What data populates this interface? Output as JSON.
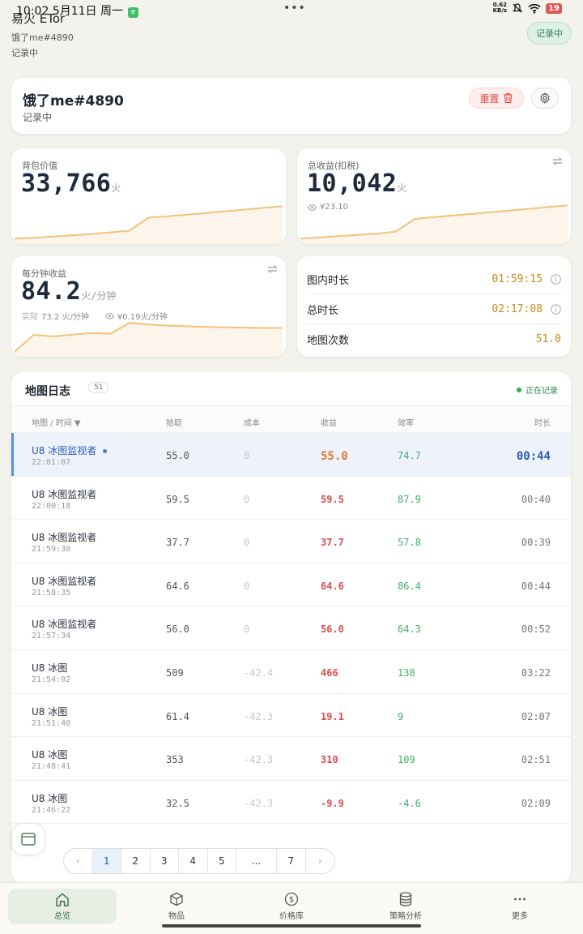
{
  "statusbar": {
    "time": "10:02",
    "date": "5月11日 周一",
    "app_badge": "e",
    "dots": "•••",
    "net_speed": "0.62",
    "net_unit": "KB/s",
    "battery": "19"
  },
  "header": {
    "title": "易火 ETor",
    "username": "饿了me#4890",
    "status": "记录中",
    "recording_pill": "记录中"
  },
  "profile": {
    "name": "饿了me#4890",
    "status": "记录中",
    "reset_label": "重置"
  },
  "stats": {
    "backpack": {
      "label": "背包价值",
      "value": "33,766",
      "unit": "火",
      "trend": [
        0.05,
        0.07,
        0.1,
        0.13,
        0.16,
        0.2,
        0.24,
        0.55,
        0.58,
        0.62,
        0.66,
        0.7,
        0.74,
        0.78,
        0.82
      ]
    },
    "total": {
      "label": "总收益(扣税)",
      "value": "10,042",
      "unit": "火",
      "sub": "¥23.10",
      "trend": [
        0.05,
        0.08,
        0.11,
        0.14,
        0.17,
        0.22,
        0.52,
        0.56,
        0.6,
        0.64,
        0.68,
        0.72,
        0.76,
        0.8,
        0.84
      ]
    },
    "per_minute": {
      "label": "每分钟收益",
      "value": "84.2",
      "unit": "火/分钟",
      "sub_real_label": "实际",
      "sub_real_value": "73.2 火/分钟",
      "sub_cny": "¥0.19火/分钟",
      "trend": [
        0.05,
        0.55,
        0.5,
        0.55,
        0.6,
        0.58,
        0.9,
        0.85,
        0.82,
        0.8,
        0.78,
        0.77,
        0.76,
        0.75,
        0.75
      ]
    }
  },
  "times": [
    {
      "label": "图内时长",
      "value": "01:59:15"
    },
    {
      "label": "总时长",
      "value": "02:17:08"
    },
    {
      "label": "地图次数",
      "value": "51.0"
    }
  ],
  "log": {
    "title": "地图日志",
    "count": "51",
    "recording": "正在记录",
    "headers": [
      "地图 / 时间 ▼",
      "拾取",
      "成本",
      "收益",
      "效率",
      "时长"
    ],
    "rows": [
      {
        "map": "U8 冰图监视者",
        "time": "22:01:07",
        "pickup": "55.0",
        "cost": "0",
        "revenue": "55.0",
        "efficiency": "74.7",
        "duration": "00:44"
      },
      {
        "map": "U8 冰图监视者",
        "time": "22:00:18",
        "pickup": "59.5",
        "cost": "0",
        "revenue": "59.5",
        "efficiency": "87.9",
        "duration": "00:40"
      },
      {
        "map": "U8 冰图监视者",
        "time": "21:59:30",
        "pickup": "37.7",
        "cost": "0",
        "revenue": "37.7",
        "efficiency": "57.8",
        "duration": "00:39"
      },
      {
        "map": "U8 冰图监视者",
        "time": "21:58:35",
        "pickup": "64.6",
        "cost": "0",
        "revenue": "64.6",
        "efficiency": "86.4",
        "duration": "00:44"
      },
      {
        "map": "U8 冰图监视者",
        "time": "21:57:34",
        "pickup": "56.0",
        "cost": "0",
        "revenue": "56.0",
        "efficiency": "64.3",
        "duration": "00:52"
      },
      {
        "map": "U8 冰图",
        "time": "21:54:02",
        "pickup": "509",
        "cost": "-42.4",
        "revenue": "466",
        "efficiency": "138",
        "duration": "03:22"
      },
      {
        "map": "U8 冰图",
        "time": "21:51:40",
        "pickup": "61.4",
        "cost": "-42.3",
        "revenue": "19.1",
        "efficiency": "9",
        "duration": "02:07"
      },
      {
        "map": "U8 冰图",
        "time": "21:48:41",
        "pickup": "353",
        "cost": "-42.3",
        "revenue": "310",
        "efficiency": "109",
        "duration": "02:51"
      },
      {
        "map": "U8 冰图",
        "time": "21:46:22",
        "pickup": "32.5",
        "cost": "-42.3",
        "revenue": "-9.9",
        "efficiency": "-4.6",
        "duration": "02:09"
      }
    ]
  },
  "pager": {
    "prev": "‹",
    "pages": [
      "1",
      "2",
      "3",
      "4",
      "5",
      "...",
      "7"
    ],
    "next": "›",
    "current": "1"
  },
  "nav": [
    {
      "label": "总览",
      "icon": "home-icon"
    },
    {
      "label": "物品",
      "icon": "box-icon"
    },
    {
      "label": "价格库",
      "icon": "dollar-icon"
    },
    {
      "label": "策略分析",
      "icon": "database-icon"
    },
    {
      "label": "更多",
      "icon": "more-icon"
    }
  ],
  "colors": {
    "accent_orange": "#c98a1a",
    "revenue_red": "#e24a4a",
    "efficiency_green": "#3fae6c",
    "active_blue": "#2b5bb5",
    "sparkline": "#f2c27c"
  }
}
